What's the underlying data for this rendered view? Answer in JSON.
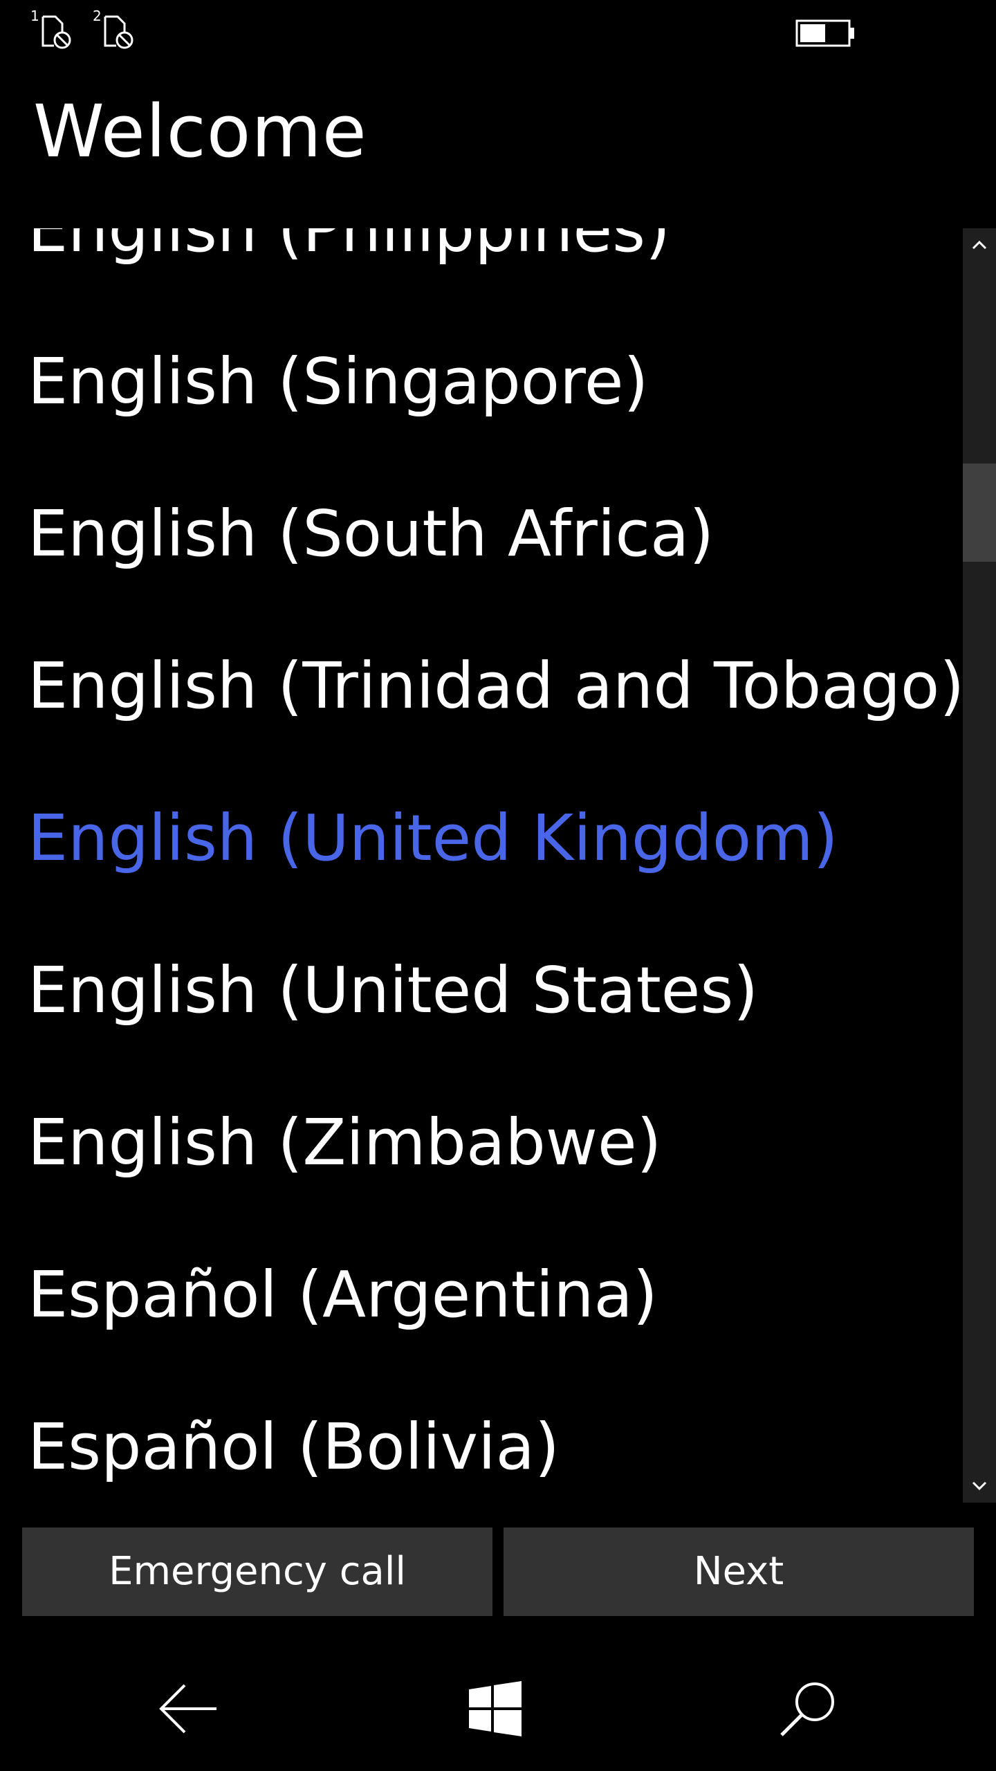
{
  "status_bar": {
    "sim1_label": "1",
    "sim2_label": "2",
    "icons": [
      "sim1-no-service-icon",
      "sim2-no-service-icon",
      "battery-icon"
    ],
    "battery_level": 0.55
  },
  "header": {
    "title": "Welcome"
  },
  "language_list": {
    "items": [
      "English (Philippines)",
      "English (Singapore)",
      "English (South Africa)",
      "English (Trinidad and Tobago)",
      "English (United Kingdom)",
      "English (United States)",
      "English (Zimbabwe)",
      "Español (Argentina)",
      "Español (Bolivia)"
    ],
    "selected": "English (United Kingdom)",
    "selected_color": "#4a66e8"
  },
  "buttons": {
    "emergency_label": "Emergency call",
    "next_label": "Next"
  },
  "nav_bar": {
    "icons": [
      "back-arrow-icon",
      "windows-start-icon",
      "search-icon"
    ]
  },
  "colors": {
    "background": "#000000",
    "button_bg": "#333333",
    "scrollbar_track": "#1f1f1f",
    "scrollbar_thumb": "#404040",
    "accent": "#4a66e8"
  }
}
